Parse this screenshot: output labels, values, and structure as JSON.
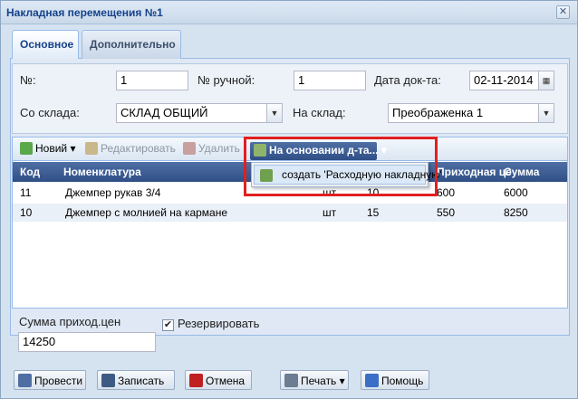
{
  "window": {
    "title": "Накладная перемещения №1",
    "close_icon": "close-icon"
  },
  "tabs": [
    {
      "label": "Основное"
    },
    {
      "label": "Дополнительно"
    }
  ],
  "form": {
    "number_label": "№:",
    "number_value": "1",
    "manual_number_label": "№ ручной:",
    "manual_number_value": "1",
    "date_label": "Дата док-та:",
    "date_value": "02-11-2014",
    "from_warehouse_label": "Со склада:",
    "from_warehouse_value": "СКЛАД ОБЩИЙ",
    "to_warehouse_label": "На склад:",
    "to_warehouse_value": "Преображенка 1"
  },
  "toolbar": {
    "new_label": "Новий",
    "edit_label": "Редактировать",
    "delete_label": "Удалить",
    "based_on_label": "На основании д-та..."
  },
  "menu": {
    "create_label": "создать 'Расходную накладную'"
  },
  "grid": {
    "columns": [
      "Код",
      "Номенклатура",
      "Приходная це",
      "Сумма"
    ],
    "rows": [
      {
        "code": "11",
        "name": "Джемпер рукав 3/4",
        "unit": "шт",
        "qty": "10",
        "price": "600",
        "sum": "6000"
      },
      {
        "code": "10",
        "name": "Джемпер с молнией на кармане",
        "unit": "шт",
        "qty": "15",
        "price": "550",
        "sum": "8250"
      }
    ]
  },
  "footer": {
    "sum_label": "Сумма приход.цен",
    "sum_value": "14250",
    "reserve_label": "Резервировать",
    "reserve_checked": true
  },
  "buttons": {
    "post": "Провести",
    "save": "Записать",
    "cancel": "Отмена",
    "print": "Печать",
    "help": "Помощь"
  },
  "colors": {
    "accent": "#2f4f86",
    "highlight": "#e02020"
  }
}
